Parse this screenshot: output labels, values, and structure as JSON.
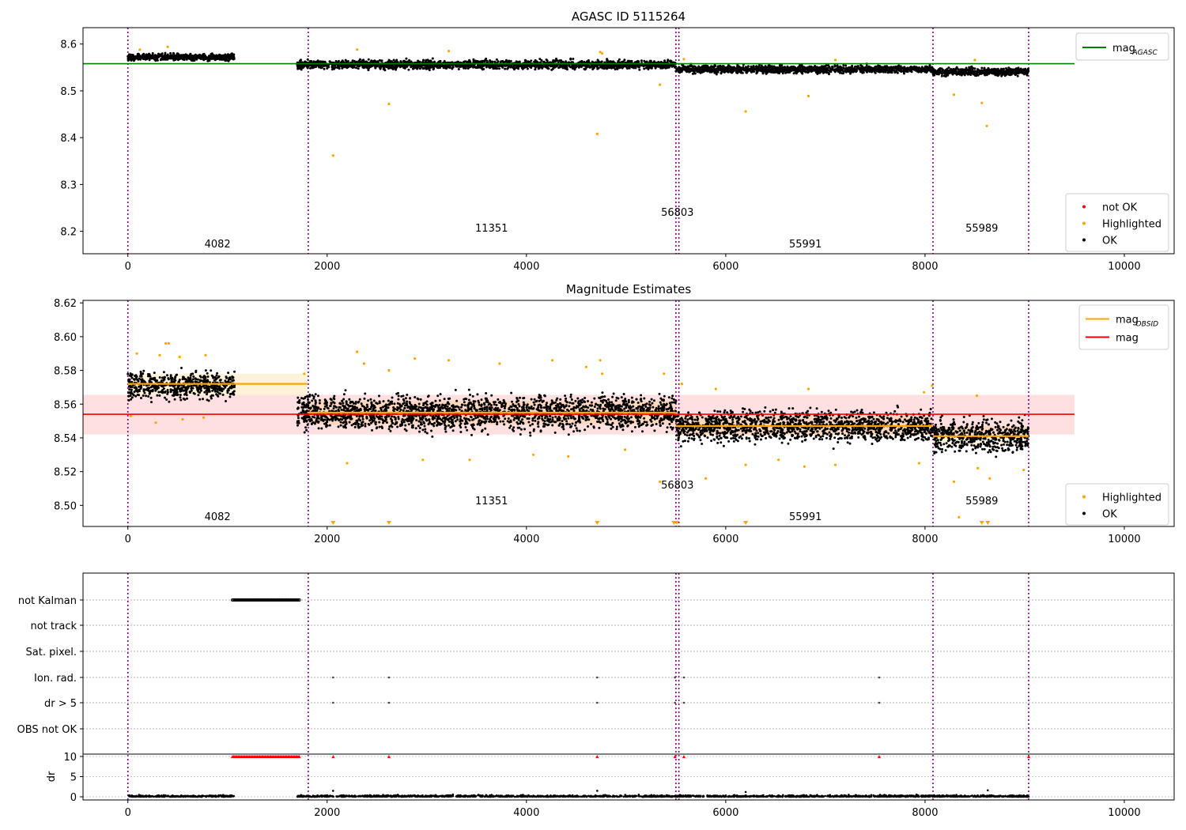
{
  "chart_data": [
    {
      "type": "scatter",
      "title": "AGASC ID 5115264",
      "xlim": [
        -450,
        10500
      ],
      "ylim": [
        8.152,
        8.635
      ],
      "xticks": [
        0,
        2000,
        4000,
        6000,
        8000,
        10000
      ],
      "yticks": [
        8.2,
        8.3,
        8.4,
        8.5,
        8.6
      ],
      "ytick_labels": [
        "8.2",
        "8.3",
        "8.4",
        "8.5",
        "8.6"
      ],
      "grid": false,
      "reference_line": {
        "label": "mag",
        "label_sub": "AGASC",
        "y": 8.558,
        "x": [
          -450,
          9500
        ],
        "color": "#008000"
      },
      "series": [
        {
          "name": "not OK",
          "color": "#ff0000",
          "points": []
        },
        {
          "name": "Highlighted",
          "color": "#ffa500",
          "points": [
            [
              2060,
              8.362
            ],
            [
              2620,
              8.472
            ],
            [
              4710,
              8.408
            ],
            [
              5340,
              8.513
            ],
            [
              6200,
              8.456
            ],
            [
              6830,
              8.489
            ],
            [
              8290,
              8.492
            ],
            [
              8570,
              8.474
            ],
            [
              8620,
              8.425
            ],
            [
              120,
              8.588
            ],
            [
              400,
              8.594
            ],
            [
              2300,
              8.588
            ],
            [
              3220,
              8.585
            ],
            [
              4740,
              8.583
            ],
            [
              4760,
              8.58
            ],
            [
              5580,
              8.568
            ],
            [
              7100,
              8.566
            ],
            [
              8500,
              8.566
            ]
          ]
        },
        {
          "name": "OK",
          "color": "#000000",
          "segments": [
            {
              "x": [
                0,
                1070
              ],
              "y_center": 8.572,
              "y_spread": 0.006
            },
            {
              "x": [
                1700,
                5500
              ],
              "y_center": 8.556,
              "y_spread": 0.008
            },
            {
              "x": [
                5500,
                8080
              ],
              "y_center": 8.546,
              "y_spread": 0.007
            },
            {
              "x": [
                8080,
                9040
              ],
              "y_center": 8.541,
              "y_spread": 0.007
            }
          ]
        }
      ],
      "legends": [
        {
          "position": "upper-right",
          "entries": [
            {
              "label": "mag",
              "sub": "AGASC",
              "kind": "line",
              "color": "#008000"
            }
          ]
        },
        {
          "position": "lower-right",
          "entries": [
            {
              "label": "not OK",
              "kind": "dot",
              "color": "#ff0000"
            },
            {
              "label": "Highlighted",
              "kind": "dot",
              "color": "#ffa500"
            },
            {
              "label": "OK",
              "kind": "dot",
              "color": "#000000"
            }
          ]
        }
      ]
    },
    {
      "type": "scatter",
      "title": "Magnitude Estimates",
      "xlim": [
        -450,
        10500
      ],
      "ylim": [
        8.4875,
        8.6215
      ],
      "xticks": [
        0,
        2000,
        4000,
        6000,
        8000,
        10000
      ],
      "yticks": [
        8.5,
        8.52,
        8.54,
        8.56,
        8.58,
        8.6,
        8.62
      ],
      "ytick_labels": [
        "8.50",
        "8.52",
        "8.54",
        "8.56",
        "8.58",
        "8.60",
        "8.62"
      ],
      "grid": false,
      "mag_line": {
        "label": "mag",
        "y": 8.554,
        "band": [
          8.542,
          8.5655
        ],
        "x": [
          -450,
          9500
        ],
        "color": "#ff0000"
      },
      "mag_obsid": {
        "label": "mag",
        "label_sub": "OBSID",
        "color": "#ffa500",
        "segments": [
          {
            "x": [
              0,
              1800
            ],
            "y": 8.572,
            "band": [
              8.5655,
              8.578
            ]
          },
          {
            "x": [
              1800,
              5500
            ],
            "y": 8.555,
            "band": [
              8.548,
              8.562
            ]
          },
          {
            "x": [
              5500,
              8080
            ],
            "y": 8.547,
            "band": [
              8.541,
              8.553
            ]
          },
          {
            "x": [
              8080,
              9040
            ],
            "y": 8.541,
            "band": [
              8.536,
              8.547
            ]
          }
        ]
      },
      "series": [
        {
          "name": "Highlighted",
          "color": "#ffa500",
          "points": [
            [
              90,
              8.59
            ],
            [
              320,
              8.589
            ],
            [
              380,
              8.596
            ],
            [
              410,
              8.596
            ],
            [
              520,
              8.588
            ],
            [
              780,
              8.589
            ],
            [
              2300,
              8.591
            ],
            [
              2370,
              8.584
            ],
            [
              2620,
              8.58
            ],
            [
              2880,
              8.587
            ],
            [
              3220,
              8.586
            ],
            [
              3730,
              8.584
            ],
            [
              4260,
              8.586
            ],
            [
              4600,
              8.582
            ],
            [
              4740,
              8.586
            ],
            [
              4760,
              8.578
            ],
            [
              5380,
              8.578
            ],
            [
              5560,
              8.572
            ],
            [
              5900,
              8.569
            ],
            [
              6830,
              8.569
            ],
            [
              7990,
              8.567
            ],
            [
              8070,
              8.571
            ],
            [
              8520,
              8.565
            ],
            [
              2200,
              8.525
            ],
            [
              2960,
              8.527
            ],
            [
              3430,
              8.527
            ],
            [
              4070,
              8.53
            ],
            [
              4420,
              8.529
            ],
            [
              4990,
              8.533
            ],
            [
              5340,
              8.514
            ],
            [
              5800,
              8.516
            ],
            [
              6200,
              8.524
            ],
            [
              6530,
              8.527
            ],
            [
              6790,
              8.523
            ],
            [
              7100,
              8.524
            ],
            [
              7940,
              8.525
            ],
            [
              8290,
              8.514
            ],
            [
              8340,
              8.493
            ],
            [
              8530,
              8.522
            ],
            [
              8650,
              8.516
            ],
            [
              8990,
              8.521
            ],
            [
              30,
              8.553
            ],
            [
              280,
              8.549
            ],
            [
              550,
              8.551
            ],
            [
              760,
              8.552
            ],
            [
              1830,
              8.555
            ],
            [
              1770,
              8.578
            ]
          ]
        },
        {
          "name": "Highlighted (below axis)",
          "marker": "down-triangle",
          "color": "#ffa500",
          "points": [
            [
              2060,
              8.4875
            ],
            [
              2620,
              8.4875
            ],
            [
              4710,
              8.4875
            ],
            [
              5480,
              8.4875
            ],
            [
              5510,
              8.4875
            ],
            [
              6200,
              8.4875
            ],
            [
              8570,
              8.4875
            ],
            [
              8630,
              8.4875
            ]
          ]
        },
        {
          "name": "OK",
          "color": "#000000",
          "segments": [
            {
              "x": [
                0,
                1070
              ],
              "y_center": 8.571,
              "y_spread": 0.007
            },
            {
              "x": [
                1700,
                5500
              ],
              "y_center": 8.555,
              "y_spread": 0.009
            },
            {
              "x": [
                5500,
                8080
              ],
              "y_center": 8.547,
              "y_spread": 0.008
            },
            {
              "x": [
                8080,
                9040
              ],
              "y_center": 8.541,
              "y_spread": 0.008
            }
          ]
        }
      ],
      "legends": [
        {
          "position": "upper-right",
          "entries": [
            {
              "label": "mag",
              "sub": "OBSID",
              "kind": "line",
              "color": "#ffa500"
            },
            {
              "label": "mag",
              "kind": "line",
              "color": "#ff0000"
            }
          ]
        },
        {
          "position": "lower-right",
          "entries": [
            {
              "label": "Highlighted",
              "kind": "dot",
              "color": "#ffa500"
            },
            {
              "label": "OK",
              "kind": "dot",
              "color": "#000000"
            }
          ]
        }
      ]
    },
    {
      "type": "scatter",
      "title": "",
      "xlim": [
        -450,
        10500
      ],
      "xticks": [
        0,
        2000,
        4000,
        6000,
        8000,
        10000
      ],
      "flag_rows": [
        "not Kalman",
        "not track",
        "Sat. pixel.",
        "Ion. rad.",
        "dr > 5",
        "OBS not OK"
      ],
      "flags": [
        {
          "row": "not Kalman",
          "x": [
            1050,
            1720
          ],
          "count": 70
        },
        {
          "row": "Ion. rad.",
          "x": [
            2060,
            2620,
            4710,
            5490,
            5580,
            7540
          ]
        },
        {
          "row": "dr > 5",
          "x": [
            2060,
            2620,
            4710,
            5490,
            5580,
            7540
          ]
        }
      ],
      "dr": {
        "ylabel": "dr",
        "yticks": [
          0,
          5,
          10
        ],
        "ylim": [
          0,
          10
        ],
        "clipped_at_10": {
          "color": "#ff0000",
          "x_range": [
            1050,
            1720
          ],
          "x": [
            2060,
            2620,
            4710,
            5490,
            5580,
            7540,
            9040
          ]
        },
        "ok_segments": [
          [
            0,
            1070
          ],
          [
            1700,
            5500
          ],
          [
            5500,
            8080
          ],
          [
            8080,
            9040
          ]
        ],
        "outliers": [
          [
            2060,
            1.5
          ],
          [
            4710,
            1.5
          ],
          [
            6200,
            1.2
          ],
          [
            8630,
            1.6
          ]
        ]
      }
    }
  ],
  "obsid_boundaries": [
    0,
    1810,
    5500,
    5530,
    8080,
    9040
  ],
  "obsid_labels": [
    {
      "text": "4082",
      "x": 900,
      "row": "low"
    },
    {
      "text": "11351",
      "x": 3650,
      "row": "mid"
    },
    {
      "text": "56803",
      "x": 5515,
      "row": "high"
    },
    {
      "text": "55991",
      "x": 6800,
      "row": "low"
    },
    {
      "text": "55989",
      "x": 8570,
      "row": "mid"
    }
  ],
  "boundary_color": "#800080"
}
